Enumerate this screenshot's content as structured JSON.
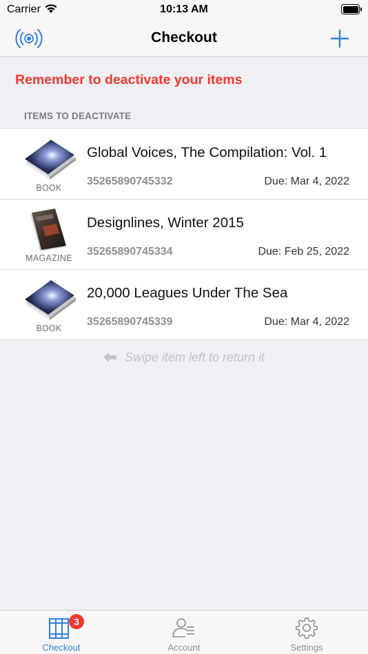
{
  "status_bar": {
    "carrier": "Carrier",
    "time": "10:13 AM"
  },
  "nav": {
    "title": "Checkout",
    "left_icon": "rfid-signal-icon",
    "right_icon": "plus-icon"
  },
  "warning": "Remember to deactivate your items",
  "section_header": "ITEMS TO DEACTIVATE",
  "items": [
    {
      "type": "BOOK",
      "title": "Global Voices, The Compilation: Vol. 1",
      "barcode": "35265890745332",
      "due": "Due: Mar 4, 2022"
    },
    {
      "type": "MAGAZINE",
      "title": "Designlines, Winter 2015",
      "barcode": "35265890745334",
      "due": "Due: Feb 25, 2022"
    },
    {
      "type": "BOOK",
      "title": "20,000 Leagues Under The Sea",
      "barcode": "35265890745339",
      "due": "Due: Mar 4, 2022"
    }
  ],
  "hint": "Swipe item left to return it",
  "tabs": [
    {
      "label": "Checkout",
      "icon": "books-icon",
      "badge": "3",
      "active": true
    },
    {
      "label": "Account",
      "icon": "person-list-icon",
      "active": false
    },
    {
      "label": "Settings",
      "icon": "gear-icon",
      "active": false
    }
  ],
  "colors": {
    "accent": "#2f80e0",
    "warning": "#f2392f",
    "badge": "#f2392f"
  }
}
